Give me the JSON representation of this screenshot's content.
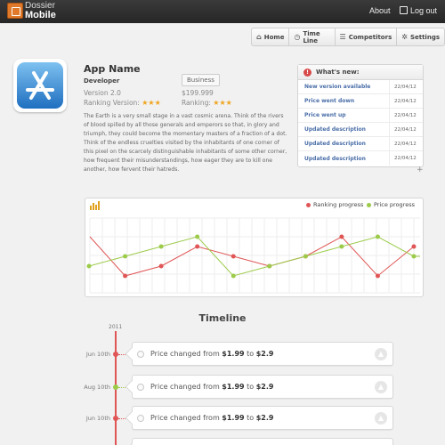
{
  "brand": {
    "line1": "Dossier",
    "line2": "Mobile"
  },
  "topnav": {
    "about": "About",
    "logout": "Log out"
  },
  "tabs": [
    {
      "label": "Home",
      "icon": "home-icon",
      "glyph": "⌂"
    },
    {
      "label": "Time Line",
      "icon": "clock-icon",
      "glyph": "◷"
    },
    {
      "label": "Competitors",
      "icon": "list-icon",
      "glyph": "☰"
    },
    {
      "label": "Settings",
      "icon": "gear-icon",
      "glyph": "✲"
    }
  ],
  "app": {
    "name": "App Name",
    "developer": "Developer",
    "category": "Business",
    "version": "Version 2.0",
    "price": "$199.999",
    "ranking_version_label": "Ranking Version:",
    "ranking_label": "Ranking:",
    "stars": "★★★",
    "description": "The Earth is a very small stage in a vast cosmic arena. Think of the rivers of blood spilled by all those generals and emperors so that, in glory and triumph, they could become the momentary masters of a fraction of a dot. Think of the endless cruelties visited by the inhabitants of one corner of this pixel on the scarcely distinguishable inhabitants of some other corner, how frequent their misunderstandings, how eager they are to kill one another, how fervent their hatreds."
  },
  "whats_new": {
    "title": "What's new:",
    "items": [
      {
        "text": "New version available",
        "date": "22/04/12"
      },
      {
        "text": "Price went down",
        "date": "22/04/12"
      },
      {
        "text": "Price went up",
        "date": "22/04/12"
      },
      {
        "text": "Updated description",
        "date": "22/04/12"
      },
      {
        "text": "Updated description",
        "date": "22/04/12"
      },
      {
        "text": "Updated description",
        "date": "22/04/12"
      }
    ],
    "add_glyph": "+"
  },
  "chart_data": {
    "type": "line",
    "legend": [
      "Ranking progress",
      "Price progress"
    ],
    "colors": [
      "#e05555",
      "#9ccb4a"
    ],
    "series": [
      {
        "name": "Ranking progress",
        "values": [
          null,
          0,
          1,
          3,
          2,
          1,
          2,
          4,
          0,
          3
        ]
      },
      {
        "name": "Price progress",
        "values": [
          1,
          2,
          3,
          4,
          0,
          1,
          2,
          3,
          4,
          2
        ]
      }
    ],
    "grid": true
  },
  "timeline": {
    "title": "Timeline",
    "year": "2011",
    "entries": [
      {
        "date": "Jun 10th",
        "color": "#e05555",
        "prefix": "Price changed from ",
        "from": "$1.99",
        "mid": " to ",
        "to": "$2.9"
      },
      {
        "date": "Aug 10th",
        "color": "#9ccb4a",
        "prefix": "Price changed from ",
        "from": "$1.99",
        "mid": " to ",
        "to": "$2.9"
      },
      {
        "date": "Jun 10th",
        "color": "#e05555",
        "prefix": "Price changed from ",
        "from": "$1.99",
        "mid": " to ",
        "to": "$2.9"
      }
    ]
  }
}
